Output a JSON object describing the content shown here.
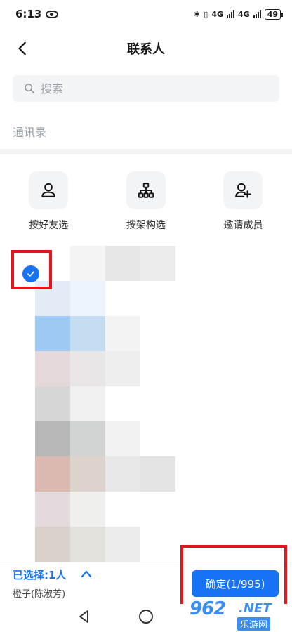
{
  "status_bar": {
    "time": "6:13",
    "network_1": "4G",
    "network_2": "4G",
    "battery": "49"
  },
  "header": {
    "title": "联系人"
  },
  "search": {
    "placeholder": "搜索"
  },
  "section": {
    "label": "通讯录"
  },
  "actions": [
    {
      "label": "按好友选",
      "icon": "user-icon"
    },
    {
      "label": "按架构选",
      "icon": "org-chart-icon"
    },
    {
      "label": "邀请成员",
      "icon": "add-user-icon"
    }
  ],
  "bottom": {
    "selected_text": "已选择:1人",
    "selected_name": "橙子(陈淑芳)",
    "confirm_label": "确定(1/995)"
  },
  "watermark": {
    "logo": "962",
    "net": ".NET",
    "sub": "乐游网"
  },
  "colors": {
    "accent": "#1772f6",
    "highlight": "#e3141b"
  }
}
